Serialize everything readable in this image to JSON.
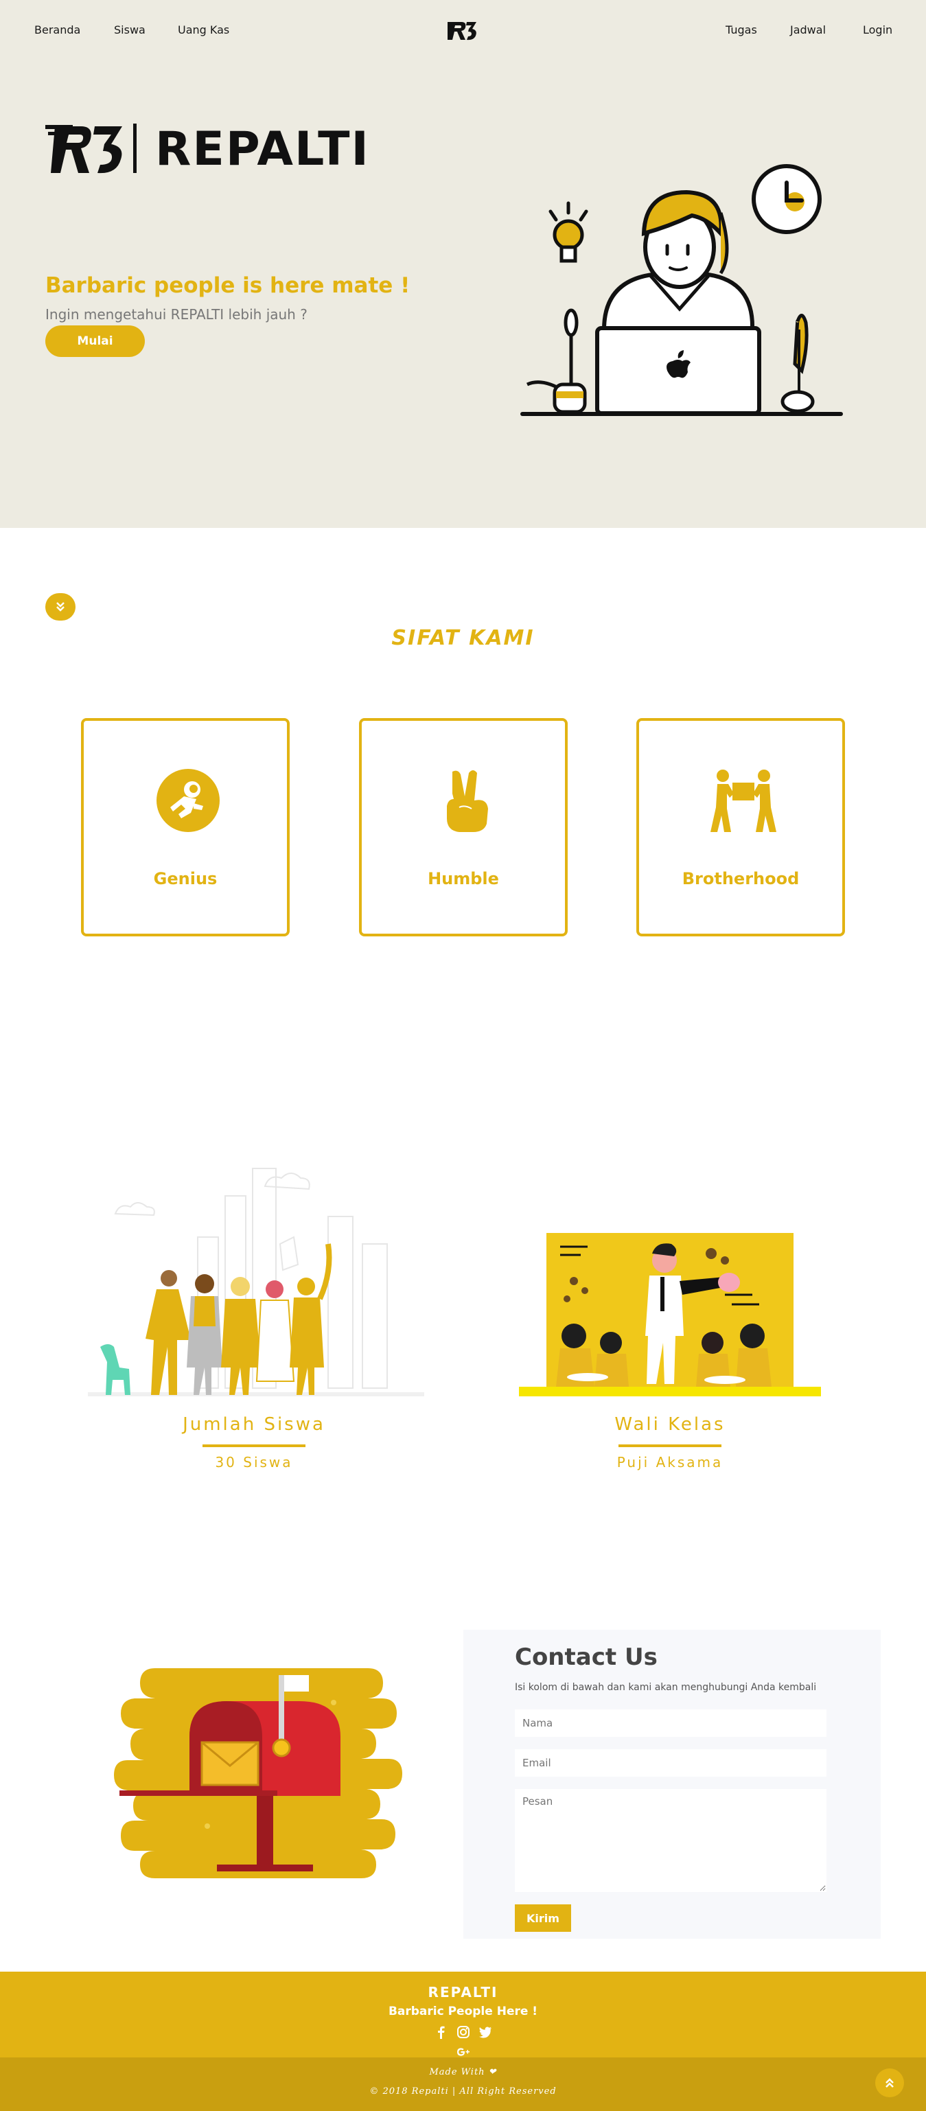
{
  "nav": {
    "left": [
      "Beranda",
      "Siswa",
      "Uang Kas"
    ],
    "right": [
      "Tugas",
      "Jadwal",
      "Login"
    ]
  },
  "hero": {
    "logo_mark": "R3",
    "brand": "REPALTI",
    "tagline": "Barbaric people is here mate !",
    "subtitle": "Ingin mengetahui REPALTI lebih jauh ?",
    "cta": "Mulai"
  },
  "sifat": {
    "scroll_icon": "chevron-double-down-icon",
    "title": "SIFAT KAMI",
    "cards": [
      {
        "label": "Genius",
        "icon": "astronaut-icon"
      },
      {
        "label": "Humble",
        "icon": "peace-hand-icon"
      },
      {
        "label": "Brotherhood",
        "icon": "people-carrying-box-icon"
      }
    ]
  },
  "stats": [
    {
      "title": "Jumlah Siswa",
      "value": "30 Siswa"
    },
    {
      "title": "Wali Kelas",
      "value": "Puji Aksama"
    }
  ],
  "contact": {
    "title": "Contact Us",
    "subtitle": "Isi kolom di bawah dan kami akan menghubungi Anda kembali",
    "name_placeholder": "Nama",
    "email_placeholder": "Email",
    "message_placeholder": "Pesan",
    "submit": "Kirim"
  },
  "footer": {
    "brand": "REPALTI",
    "tagline": "Barbaric People Here !",
    "social_icons": [
      "facebook-icon",
      "instagram-icon",
      "twitter-icon",
      "google-plus-icon"
    ],
    "made_with": "Made With ❤",
    "rights": "© 2018 Repalti | All Right Reserved"
  },
  "colors": {
    "accent": "#e2b313",
    "hero_bg": "#edebe1",
    "footer_dark": "#c99f10"
  }
}
